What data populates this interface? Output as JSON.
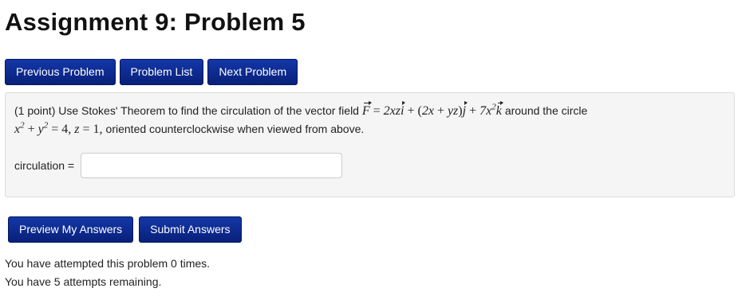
{
  "page": {
    "title": "Assignment 9: Problem 5"
  },
  "nav": {
    "previous_label": "Previous Problem",
    "list_label": "Problem List",
    "next_label": "Next Problem"
  },
  "problem": {
    "points": "(1 point)",
    "text_before_field": "Use Stokes' Theorem to find the circulation of the vector field",
    "field_expression": "F = 2xzi + (2x + yz)j + 7x²k",
    "text_after_field": "around the circle",
    "circle_expression": "x² + y² = 4, z = 1,",
    "text_orientation": "oriented counterclockwise when viewed from above."
  },
  "answer": {
    "label": "circulation =",
    "value": "",
    "placeholder": ""
  },
  "actions": {
    "preview_label": "Preview My Answers",
    "submit_label": "Submit Answers"
  },
  "status": {
    "attempts_text": "You have attempted this problem 0 times.",
    "remaining_text": "You have 5 attempts remaining."
  }
}
